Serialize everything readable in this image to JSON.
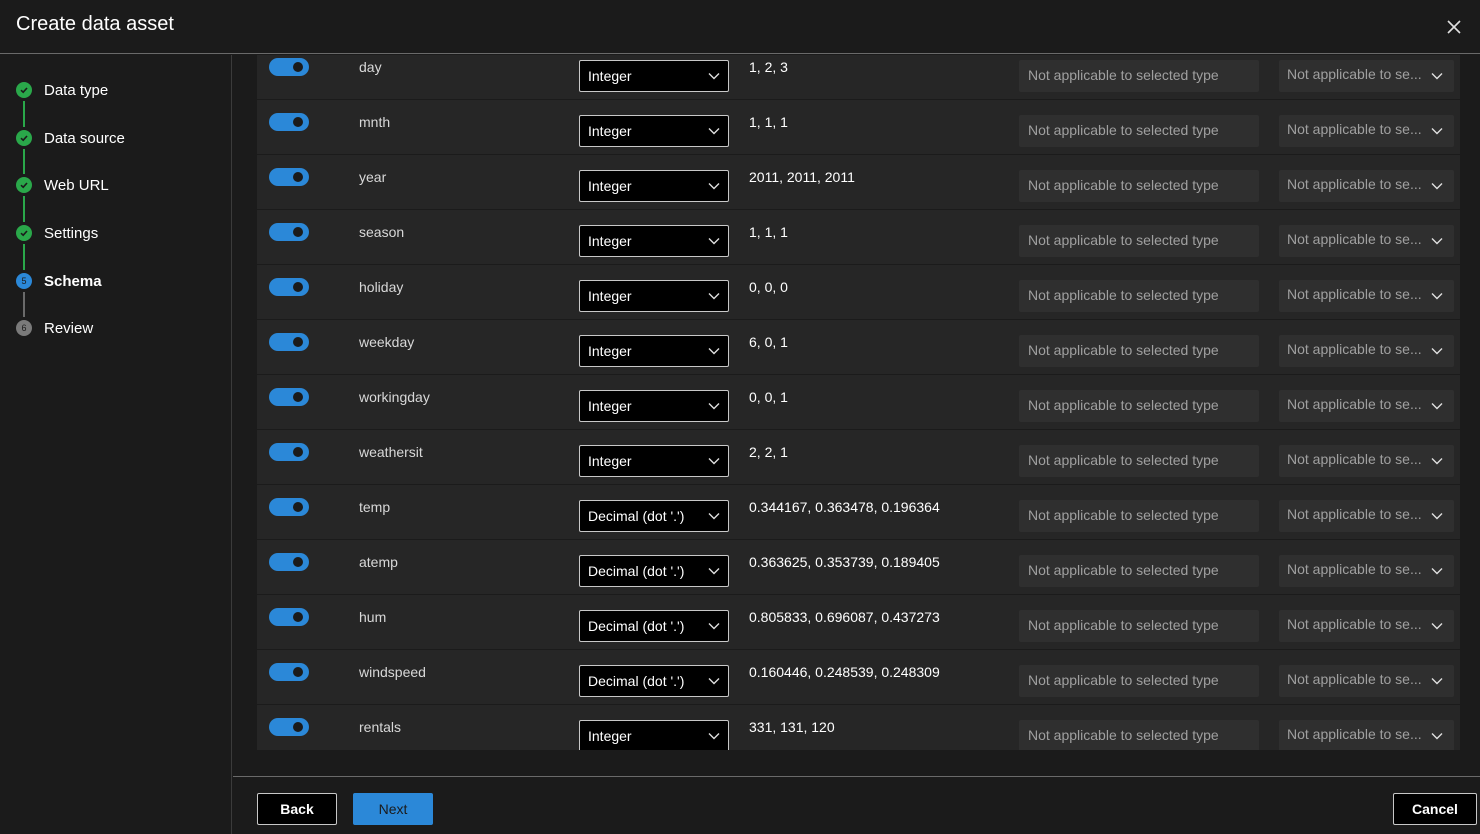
{
  "window": {
    "title": "Create data asset",
    "close_icon": "close-icon"
  },
  "steps": [
    {
      "label": "Data type",
      "status": "done",
      "marker": ""
    },
    {
      "label": "Data source",
      "status": "done",
      "marker": ""
    },
    {
      "label": "Web URL",
      "status": "done",
      "marker": ""
    },
    {
      "label": "Settings",
      "status": "done",
      "marker": ""
    },
    {
      "label": "Schema",
      "status": "current",
      "marker": "5"
    },
    {
      "label": "Review",
      "status": "todo",
      "marker": "6"
    }
  ],
  "schema": {
    "na_text_1": "Not applicable to selected type",
    "na_text_2": "Not applicable to se...",
    "rows": [
      {
        "name": "day",
        "type": "Integer",
        "sample": "1, 2, 3",
        "included": true
      },
      {
        "name": "mnth",
        "type": "Integer",
        "sample": "1, 1, 1",
        "included": true
      },
      {
        "name": "year",
        "type": "Integer",
        "sample": "2011, 2011, 2011",
        "included": true
      },
      {
        "name": "season",
        "type": "Integer",
        "sample": "1, 1, 1",
        "included": true
      },
      {
        "name": "holiday",
        "type": "Integer",
        "sample": "0, 0, 0",
        "included": true
      },
      {
        "name": "weekday",
        "type": "Integer",
        "sample": "6, 0, 1",
        "included": true
      },
      {
        "name": "workingday",
        "type": "Integer",
        "sample": "0, 0, 1",
        "included": true
      },
      {
        "name": "weathersit",
        "type": "Integer",
        "sample": "2, 2, 1",
        "included": true
      },
      {
        "name": "temp",
        "type": "Decimal (dot '.')",
        "sample": "0.344167, 0.363478, 0.196364",
        "included": true
      },
      {
        "name": "atemp",
        "type": "Decimal (dot '.')",
        "sample": "0.363625, 0.353739, 0.189405",
        "included": true
      },
      {
        "name": "hum",
        "type": "Decimal (dot '.')",
        "sample": "0.805833, 0.696087, 0.437273",
        "included": true
      },
      {
        "name": "windspeed",
        "type": "Decimal (dot '.')",
        "sample": "0.160446, 0.248539, 0.248309",
        "included": true
      },
      {
        "name": "rentals",
        "type": "Integer",
        "sample": "331, 131, 120",
        "included": true
      }
    ]
  },
  "footer": {
    "back_label": "Back",
    "next_label": "Next",
    "cancel_label": "Cancel"
  },
  "colors": {
    "accent": "#2b88d8",
    "done": "#2aa84a",
    "background": "#1b1b1b",
    "panel": "#262626"
  }
}
